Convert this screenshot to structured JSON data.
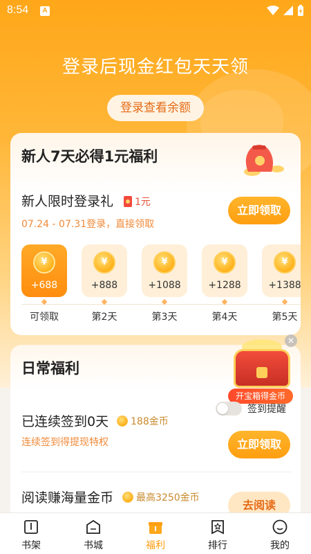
{
  "status_bar": {
    "time": "8:54",
    "badge": "A"
  },
  "hero": {
    "title": "登录后现金红包天天领",
    "check_balance_label": "登录查看余额"
  },
  "newcomer_card": {
    "title": "新人7天必得1元福利",
    "offer_title": "新人限时登录礼",
    "offer_badge": "1元",
    "offer_subtitle": "07.24 - 07.31登录，直接领取",
    "claim_label": "立即领取",
    "days": [
      {
        "amount": "+688",
        "label": "可领取",
        "active": true
      },
      {
        "amount": "+888",
        "label": "第2天",
        "active": false
      },
      {
        "amount": "+1088",
        "label": "第3天",
        "active": false
      },
      {
        "amount": "+1288",
        "label": "第4天",
        "active": false
      },
      {
        "amount": "+1388",
        "label": "第5天",
        "active": false
      }
    ],
    "coin_symbol": "¥"
  },
  "daily_card": {
    "title": "日常福利",
    "streak_title": "已连续签到0天",
    "streak_reward": "188金币",
    "streak_subtitle": "连续签到得提现特权",
    "claim_label": "立即领取",
    "read_title": "阅读赚海量金币",
    "read_reward": "最高3250金币",
    "read_button": "去阅读"
  },
  "treasure": {
    "label": "开宝箱得金币",
    "close": "✕"
  },
  "sign_reminder": {
    "label": "签到提醒",
    "enabled": false
  },
  "bottom_nav": [
    {
      "label": "书架",
      "icon": "bookshelf-icon",
      "active": false
    },
    {
      "label": "书城",
      "icon": "bookstore-icon",
      "active": false
    },
    {
      "label": "福利",
      "icon": "gift-icon",
      "active": true
    },
    {
      "label": "排行",
      "icon": "ranking-icon",
      "active": false
    },
    {
      "label": "我的",
      "icon": "profile-icon",
      "active": false
    }
  ],
  "colors": {
    "accent": "#ff9e10",
    "hero_bg": "#ffa719",
    "highlight_text": "#f08a3a"
  }
}
